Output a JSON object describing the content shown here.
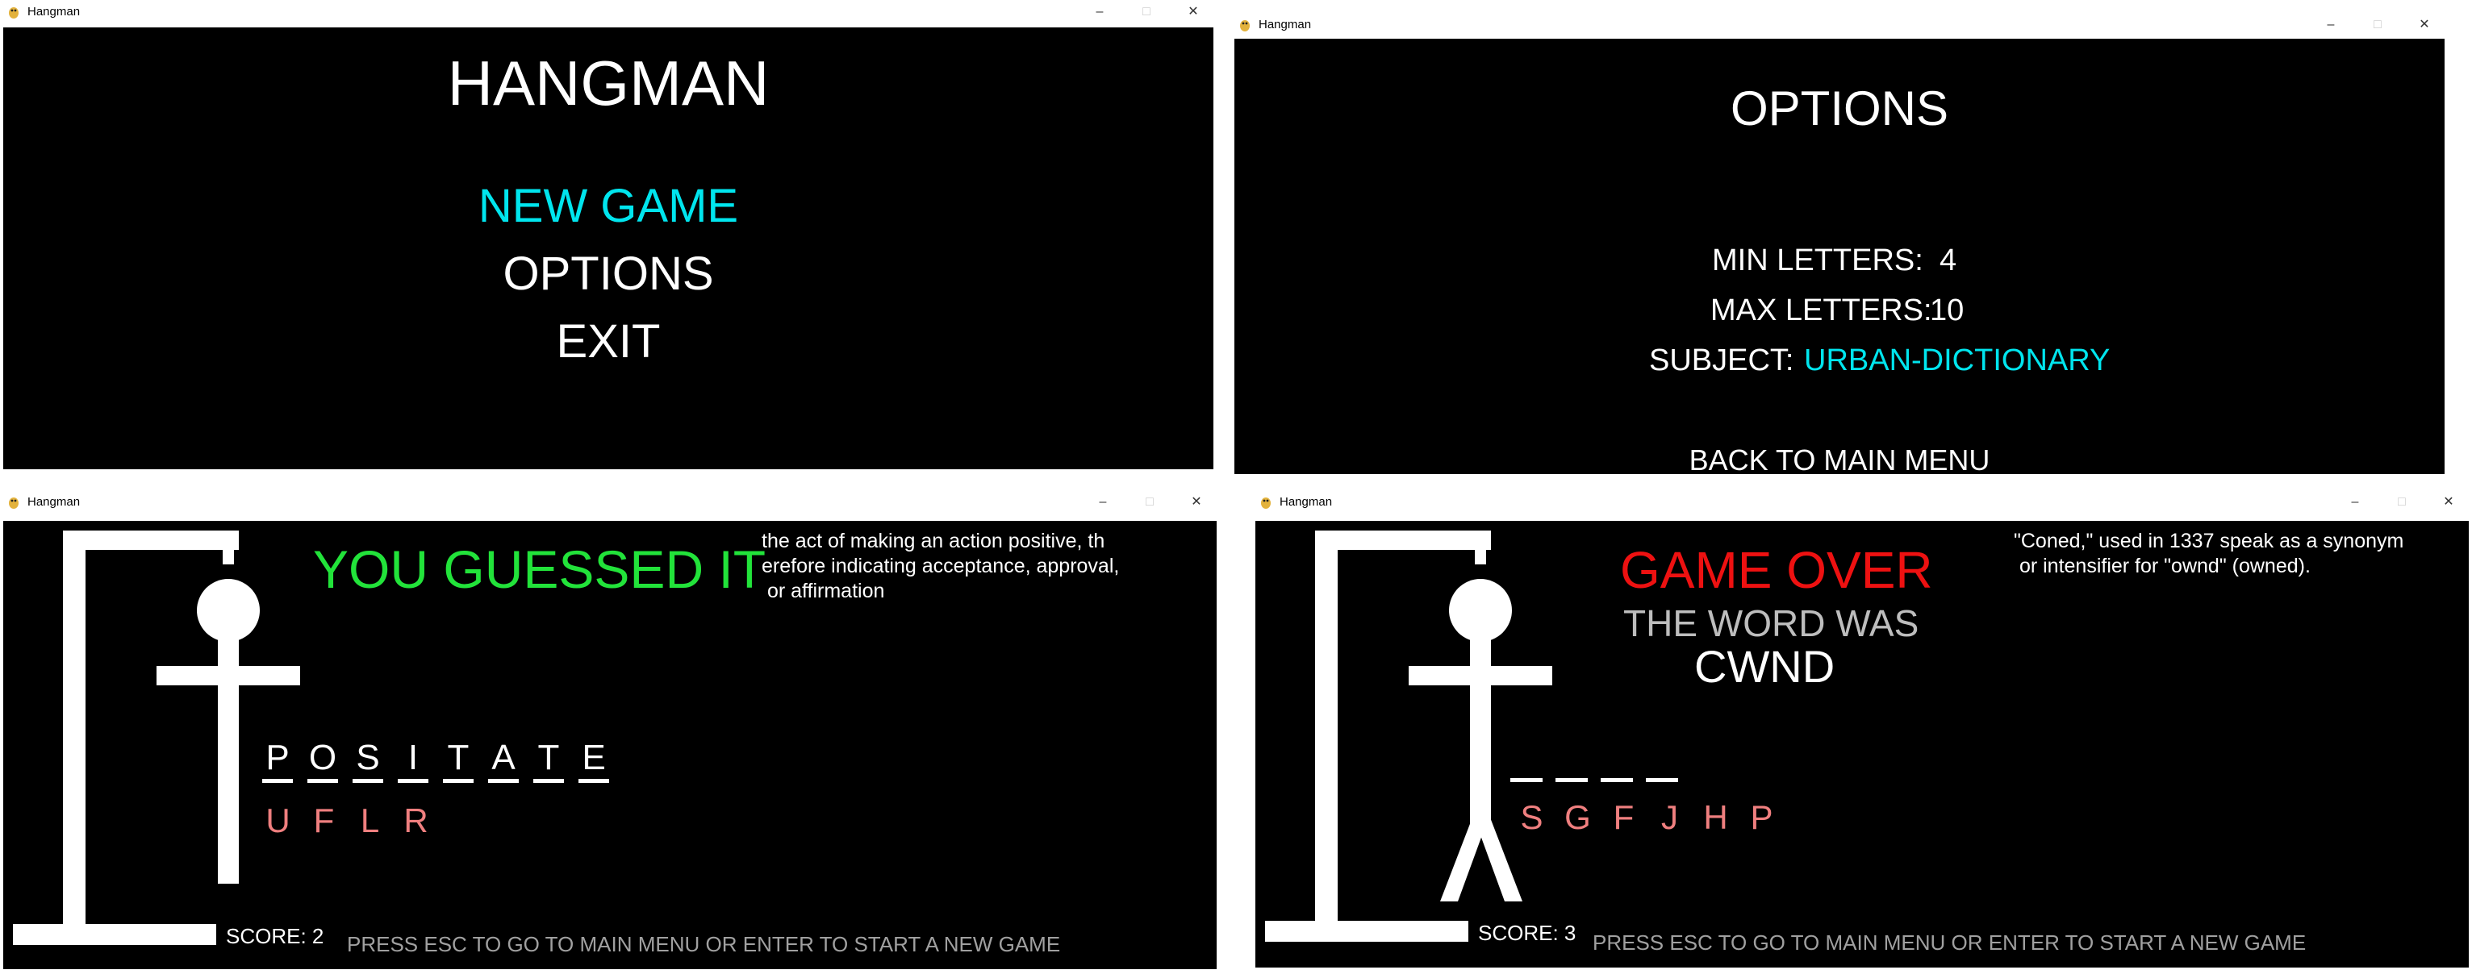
{
  "app_title": "Hangman",
  "window_controls": {
    "minimize": "–",
    "maximize": "□",
    "close": "✕"
  },
  "menu_window": {
    "title": "HANGMAN",
    "items": [
      "NEW GAME",
      "OPTIONS",
      "EXIT"
    ],
    "selected_index": 0
  },
  "options_window": {
    "title": "OPTIONS",
    "min_letters_label": "MIN LETTERS:",
    "min_letters_value": "4",
    "max_letters_label": "MAX LETTERS:",
    "max_letters_value": "10",
    "subject_label": "SUBJECT:",
    "subject_value": "URBAN-DICTIONARY",
    "back_label": "BACK TO MAIN MENU"
  },
  "win_window": {
    "result": "YOU GUESSED IT",
    "definition": "the act of making an action positive, th\nerefore indicating acceptance, approval,\n or affirmation",
    "word_letters": [
      "P",
      "O",
      "S",
      "I",
      "T",
      "A",
      "T",
      "E"
    ],
    "wrong_letters": [
      "U",
      "F",
      "L",
      "R"
    ],
    "score_label": "SCORE: 2",
    "footer": "PRESS ESC TO GO TO MAIN MENU OR ENTER TO START A NEW GAME"
  },
  "lose_window": {
    "result": "GAME OVER",
    "word_was_label": "THE WORD WAS",
    "word": "CWND",
    "definition": "\"Coned,\" used in 1337 speak as a synonym\n or intensifier for \"ownd\" (owned).",
    "blank_count": 4,
    "wrong_letters": [
      "S",
      "G",
      "F",
      "J",
      "H",
      "P"
    ],
    "score_label": "SCORE: 3",
    "footer": "PRESS ESC TO GO TO MAIN MENU OR ENTER TO START A NEW GAME"
  },
  "colors": {
    "background": "#000000",
    "text": "#ffffff",
    "highlight": "#00e5ee",
    "win": "#22e33a",
    "lose": "#ee1111",
    "wrong_letter": "#ef7f7f",
    "footer": "#a0a0a0"
  },
  "icons": {
    "app": "pygame-snake-icon"
  }
}
